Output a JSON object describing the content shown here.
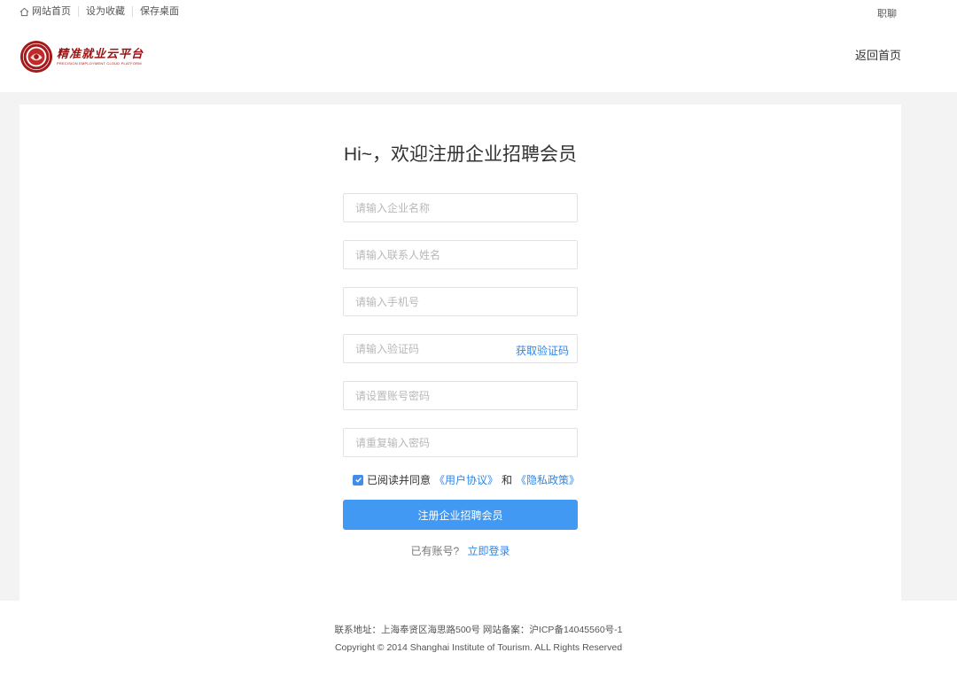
{
  "topbar": {
    "links": [
      "网站首页",
      "设为收藏",
      "保存桌面"
    ],
    "right_link": "职聊"
  },
  "header": {
    "logo_text": "精准就业云平台",
    "logo_subtext": "PRECISION EMPLOYMENT CLOUD PLATFORM",
    "back_home": "返回首页"
  },
  "form": {
    "title": "Hi~，欢迎注册企业招聘会员",
    "fields": {
      "company_name": {
        "placeholder": "请输入企业名称",
        "value": ""
      },
      "contact_name": {
        "placeholder": "请输入联系人姓名",
        "value": ""
      },
      "phone": {
        "placeholder": "请输入手机号",
        "value": ""
      },
      "code": {
        "placeholder": "请输入验证码",
        "value": ""
      },
      "password": {
        "placeholder": "请设置账号密码",
        "value": ""
      },
      "password_confirm": {
        "placeholder": "请重复输入密码",
        "value": ""
      }
    },
    "get_code": "获取验证码",
    "agree": {
      "checked": true,
      "prefix": "已阅读并同意",
      "user_agreement": "《用户协议》",
      "and": "和",
      "privacy_policy": "《隐私政策》"
    },
    "submit": "注册企业招聘会员",
    "has_account": "已有账号?",
    "login_now": "立即登录"
  },
  "footer": {
    "address": "联系地址：上海奉贤区海思路500号 网站备案：沪ICP备14045560号-1",
    "copyright": "Copyright © 2014 Shanghai Institute of Tourism. ALL Rights Reserved"
  },
  "colors": {
    "accent": "#2f86e8",
    "button": "#4199f3",
    "logo": "#9b1414",
    "background": "#f3f3f3"
  }
}
